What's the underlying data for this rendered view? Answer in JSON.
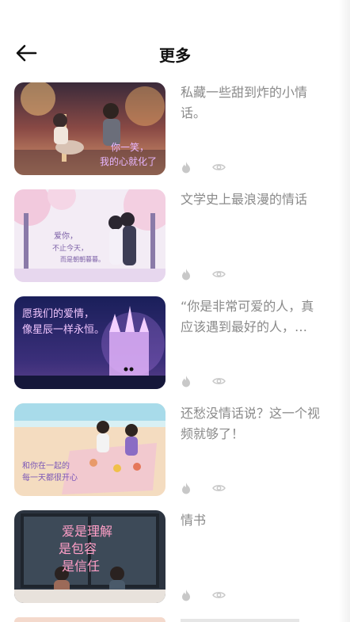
{
  "header": {
    "title": "更多",
    "back_icon": "arrow-left-icon"
  },
  "items": [
    {
      "caption": "私藏一些甜到炸的小情话。",
      "thumb_text_1": "你一笑，",
      "thumb_text_2": "我的心就化了",
      "like_icon": "flame-icon",
      "view_icon": "eye-icon"
    },
    {
      "caption": "文学史上最浪漫的情话",
      "thumb_text_1": "爱你，",
      "thumb_text_2": "不止今天，",
      "thumb_text_3": "而是朝朝暮暮。",
      "like_icon": "flame-icon",
      "view_icon": "eye-icon"
    },
    {
      "caption": "“你是非常可爱的人，真应该遇到最好的人，…",
      "thumb_text_1": "愿我们的爱情，",
      "thumb_text_2": "像星辰一样永恒。",
      "like_icon": "flame-icon",
      "view_icon": "eye-icon"
    },
    {
      "caption": "还愁没情话说？这一个视频就够了！",
      "thumb_text_1": "和你在一起的",
      "thumb_text_2": "每一天都很开心",
      "like_icon": "flame-icon",
      "view_icon": "eye-icon"
    },
    {
      "caption": "情书",
      "thumb_text_1": "爱是理解",
      "thumb_text_2": "是包容",
      "thumb_text_3": "是信任",
      "like_icon": "flame-icon",
      "view_icon": "eye-icon"
    }
  ],
  "colors": {
    "caption": "#8a8a8a",
    "title": "#111111",
    "icon": "#c8c8c8"
  }
}
